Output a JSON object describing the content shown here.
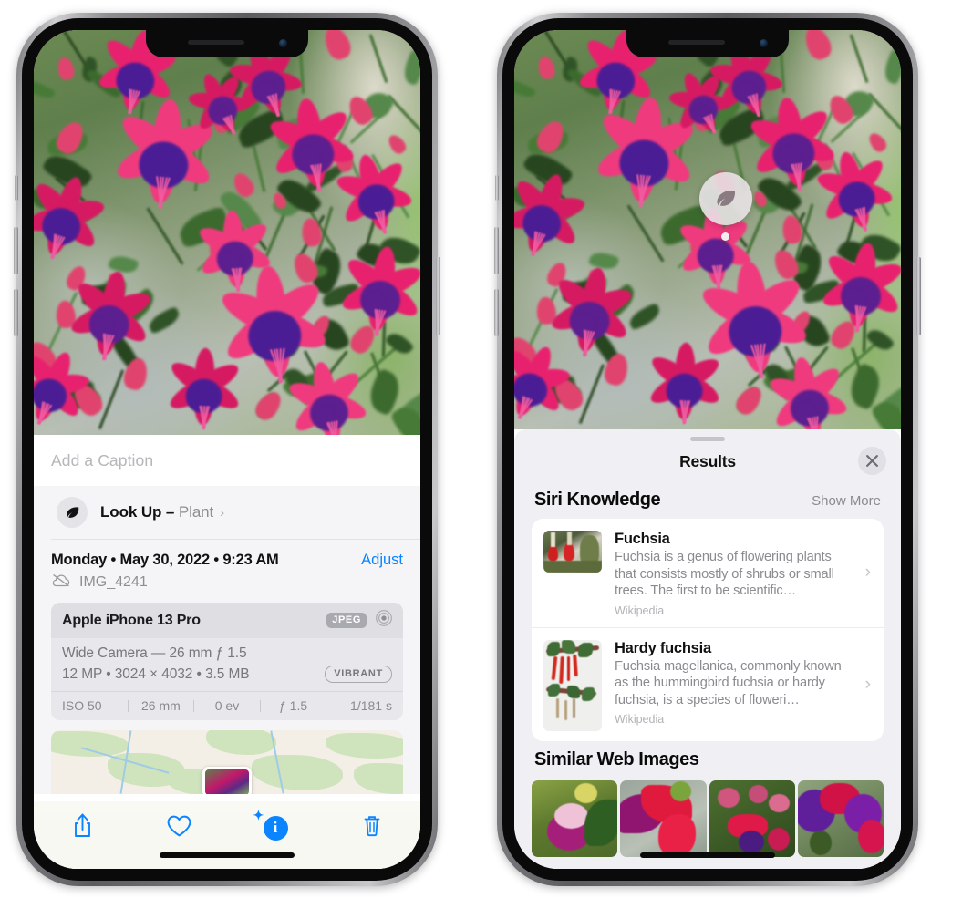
{
  "left_phone": {
    "caption_placeholder": "Add a Caption",
    "lookup": {
      "label": "Look Up",
      "dash": "–",
      "subject": "Plant",
      "chevron": "›",
      "icon": "leaf-icon",
      "sparkle": "✦"
    },
    "metadata": {
      "date_line": "Monday • May 30, 2022 • 9:23 AM",
      "adjust_label": "Adjust",
      "filename": "IMG_4241",
      "cloud_icon": "cloud-slash-icon"
    },
    "exif": {
      "device": "Apple iPhone 13 Pro",
      "format_badge": "JPEG",
      "lens_icon": "aperture-icon",
      "lens_line": "Wide Camera — 26 mm ƒ 1.5",
      "size_line": "12 MP • 3024 × 4032 • 3.5 MB",
      "style_badge": "VIBRANT",
      "settings": [
        "ISO 50",
        "26 mm",
        "0 ev",
        "ƒ 1.5",
        "1/181 s"
      ]
    },
    "toolbar": {
      "share_label": "share-icon",
      "favorite_label": "heart-icon",
      "info_label": "i",
      "delete_label": "trash-icon"
    }
  },
  "right_phone": {
    "marker_icon": "leaf-icon",
    "sheet_title": "Results",
    "close_icon": "✕",
    "siri_knowledge": {
      "title": "Siri Knowledge",
      "action": "Show More",
      "chevron": "›",
      "items": [
        {
          "name": "Fuchsia",
          "description": "Fuchsia is a genus of flowering plants that consists mostly of shrubs or small trees. The first to be scientific…",
          "source": "Wikipedia"
        },
        {
          "name": "Hardy fuchsia",
          "description": "Fuchsia magellanica, commonly known as the hummingbird fuchsia or hardy fuchsia, is a species of floweri…",
          "source": "Wikipedia"
        }
      ]
    },
    "similar_web_images": {
      "title": "Similar Web Images",
      "count": 4
    }
  },
  "colors": {
    "accent_blue": "#0a84ff",
    "sheet_gray": "#f0f0f4",
    "text_secondary": "#8a8a90"
  }
}
